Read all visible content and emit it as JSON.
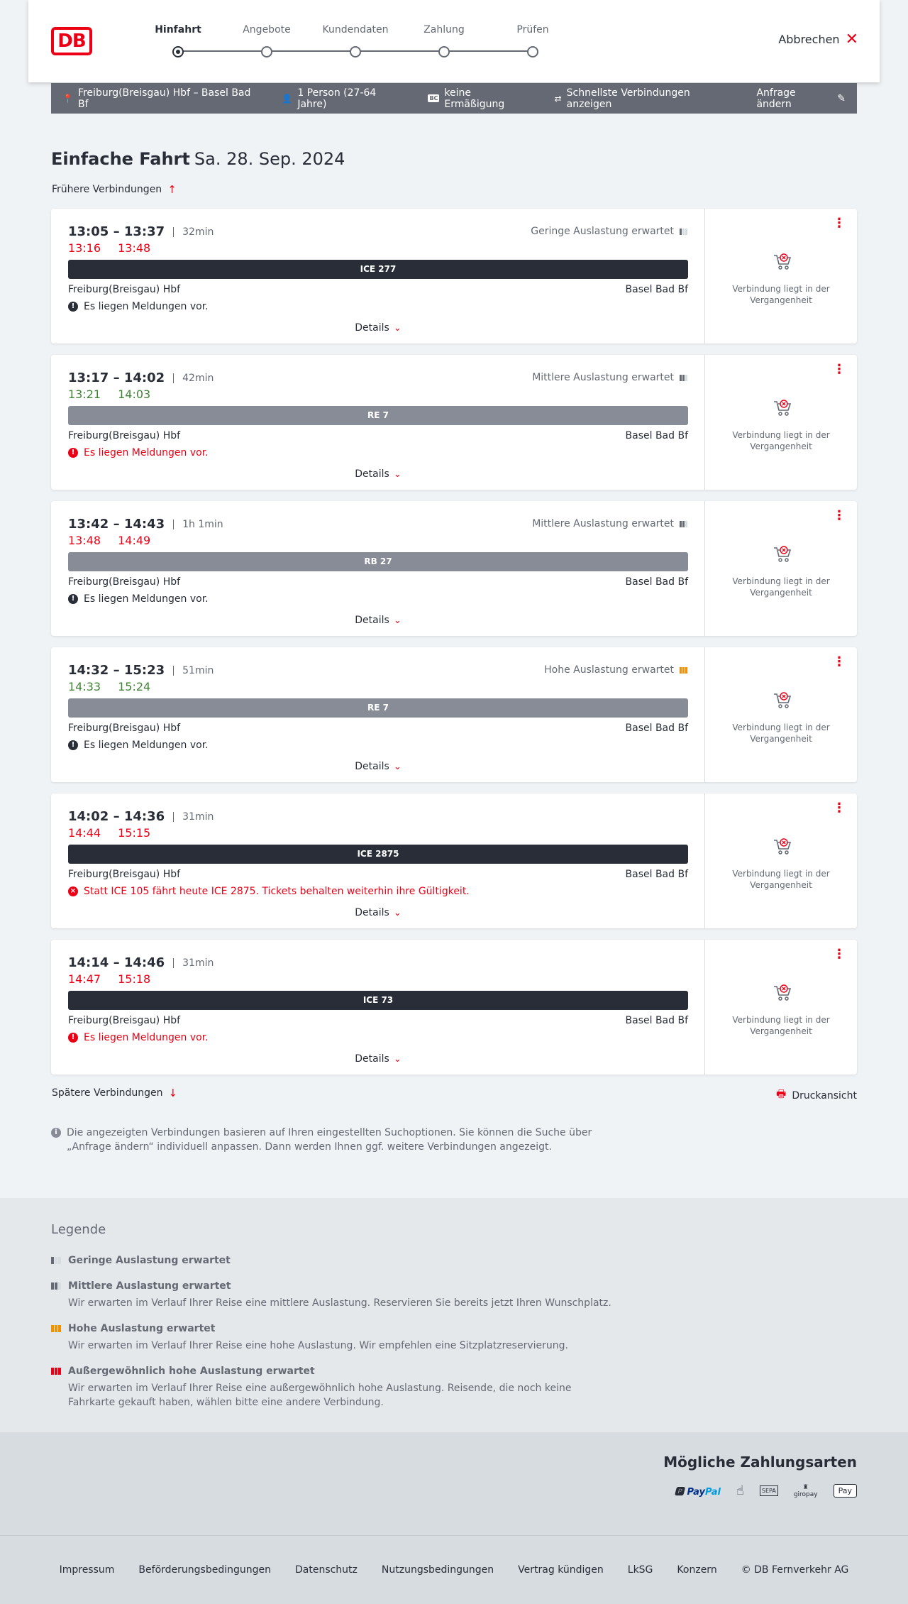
{
  "header": {
    "logo": "DB",
    "steps": [
      {
        "label": "Hinfahrt",
        "active": true
      },
      {
        "label": "Angebote",
        "active": false
      },
      {
        "label": "Kundendaten",
        "active": false
      },
      {
        "label": "Zahlung",
        "active": false
      },
      {
        "label": "Prüfen",
        "active": false
      }
    ],
    "cancel_label": "Abbrechen"
  },
  "query": {
    "route": "Freiburg(Breisgau) Hbf – Basel Bad Bf",
    "travellers": "1 Person (27-64 Jahre)",
    "discount_badge": "BC",
    "discount": "keine Ermäßigung",
    "fastest": "Schnellste Verbindungen anzeigen",
    "change": "Anfrage ändern"
  },
  "page": {
    "title": "Einfache Fahrt",
    "date": "Sa. 28. Sep. 2024",
    "earlier": "Frühere Verbindungen",
    "later": "Spätere Verbindungen",
    "print": "Druckansicht",
    "info": "Die angezeigten Verbindungen basieren auf Ihren eingestellten Suchoptionen. Sie können die Suche über „Anfrage ändern“ individuell anpassen. Dann werden Ihnen ggf. weitere Verbindungen angezeigt."
  },
  "connections": [
    {
      "times": "13:05 – 13:37",
      "duration": "32min",
      "rt_dep": "13:16",
      "rt_arr": "13:48",
      "rt_color": "red",
      "occupancy": "Geringe Auslastung erwartet",
      "train": "ICE 277",
      "bar": "dark",
      "from": "Freiburg(Breisgau) Hbf",
      "to": "Basel Bad Bf",
      "message": "Es liegen Meldungen vor.",
      "msg_color": "black",
      "details": "Details",
      "status": "Verbindung liegt in der Vergangenheit"
    },
    {
      "times": "13:17 – 14:02",
      "duration": "42min",
      "rt_dep": "13:21",
      "rt_arr": "14:03",
      "rt_color": "green",
      "occupancy": "Mittlere Auslastung erwartet",
      "train": "RE 7",
      "bar": "grey",
      "from": "Freiburg(Breisgau) Hbf",
      "to": "Basel Bad Bf",
      "message": "Es liegen Meldungen vor.",
      "msg_color": "red",
      "details": "Details",
      "status": "Verbindung liegt in der Vergangenheit"
    },
    {
      "times": "13:42 – 14:43",
      "duration": "1h 1min",
      "rt_dep": "13:48",
      "rt_arr": "14:49",
      "rt_color": "red",
      "occupancy": "Mittlere Auslastung erwartet",
      "train": "RB 27",
      "bar": "grey",
      "from": "Freiburg(Breisgau) Hbf",
      "to": "Basel Bad Bf",
      "message": "Es liegen Meldungen vor.",
      "msg_color": "black",
      "details": "Details",
      "status": "Verbindung liegt in der Vergangenheit"
    },
    {
      "times": "14:32 – 15:23",
      "duration": "51min",
      "rt_dep": "14:33",
      "rt_arr": "15:24",
      "rt_color": "green",
      "occupancy": "Hohe Auslastung erwartet",
      "train": "RE 7",
      "bar": "grey",
      "from": "Freiburg(Breisgau) Hbf",
      "to": "Basel Bad Bf",
      "message": "Es liegen Meldungen vor.",
      "msg_color": "black",
      "details": "Details",
      "status": "Verbindung liegt in der Vergangenheit"
    },
    {
      "times": "14:02 – 14:36",
      "duration": "31min",
      "rt_dep": "14:44",
      "rt_arr": "15:15",
      "rt_color": "red",
      "occupancy": "",
      "train": "ICE 2875",
      "bar": "dark",
      "from": "Freiburg(Breisgau) Hbf",
      "to": "Basel Bad Bf",
      "message": "Statt ICE 105 fährt heute ICE 2875. Tickets behalten weiterhin ihre Gültigkeit.",
      "msg_color": "red-x",
      "details": "Details",
      "status": "Verbindung liegt in der Vergangenheit"
    },
    {
      "times": "14:14 – 14:46",
      "duration": "31min",
      "rt_dep": "14:47",
      "rt_arr": "15:18",
      "rt_color": "red",
      "occupancy": "",
      "train": "ICE 73",
      "bar": "dark",
      "from": "Freiburg(Breisgau) Hbf",
      "to": "Basel Bad Bf",
      "message": "Es liegen Meldungen vor.",
      "msg_color": "red",
      "details": "Details",
      "status": "Verbindung liegt in der Vergangenheit"
    }
  ],
  "legend": {
    "title": "Legende",
    "items": [
      {
        "title": "Geringe Auslastung erwartet",
        "desc": ""
      },
      {
        "title": "Mittlere Auslastung erwartet",
        "desc": "Wir erwarten im Verlauf Ihrer Reise eine mittlere Auslastung. Reservieren Sie bereits jetzt Ihren Wunschplatz."
      },
      {
        "title": "Hohe Auslastung erwartet",
        "desc": "Wir erwarten im Verlauf Ihrer Reise eine hohe Auslastung. Wir empfehlen eine Sitzplatzreservierung."
      },
      {
        "title": "Außergewöhnlich hohe Auslastung erwartet",
        "desc": "Wir erwarten im Verlauf Ihrer Reise eine außergewöhnlich hohe Auslastung. Reisende, die noch keine Fahrkarte gekauft haben, wählen bitte eine andere Verbindung."
      }
    ]
  },
  "payment": {
    "title": "Mögliche Zahlungsarten",
    "paypal_1": "Pay",
    "paypal_2": "Pal",
    "sepa": "SEPA",
    "giropay": "giropay",
    "applepay": "Pay"
  },
  "footer": {
    "links": [
      "Impressum",
      "Beförderungsbedingungen",
      "Datenschutz",
      "Nutzungsbedingungen",
      "Vertrag kündigen",
      "LkSG",
      "Konzern",
      "© DB Fernverkehr AG"
    ]
  },
  "colors": {
    "brand_red": "#ec0016",
    "delay_red": "#ec0016",
    "on_time_green": "#408335",
    "high_occupancy": "#f39200",
    "dark_train": "#282d37",
    "grey_train": "#878c96"
  }
}
